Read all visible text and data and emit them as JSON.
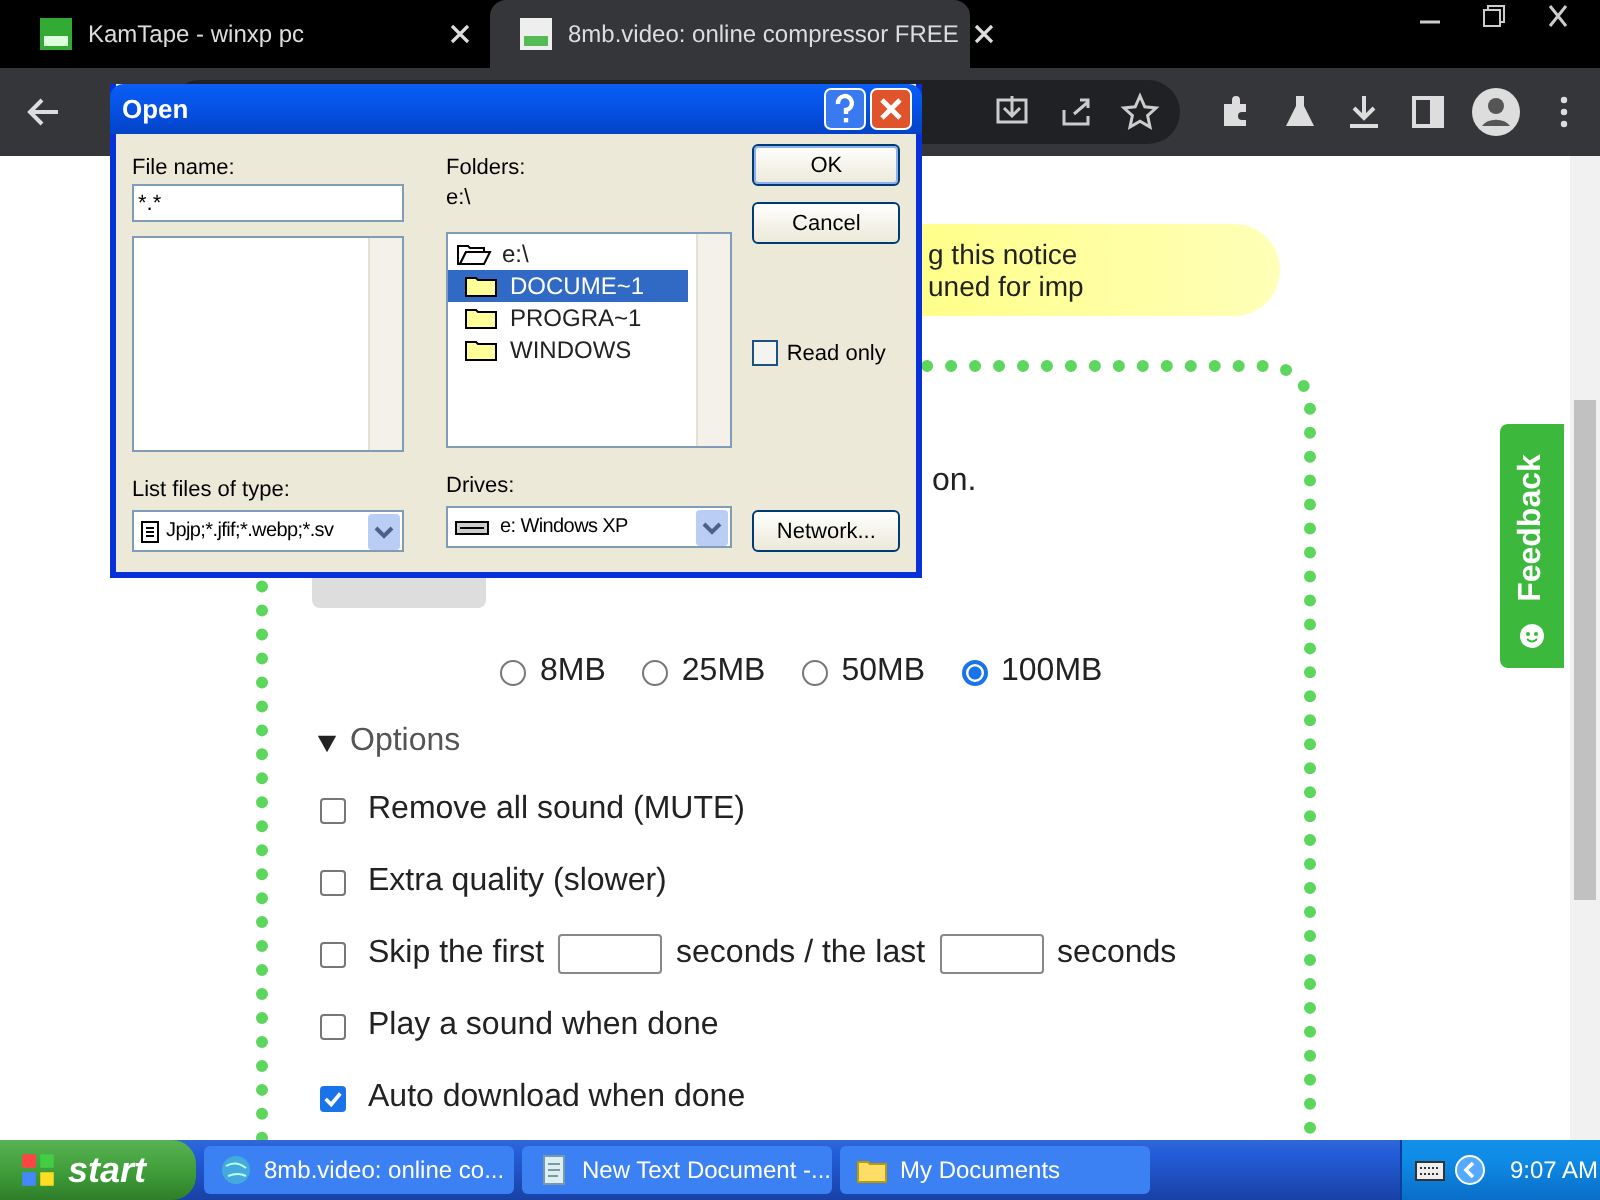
{
  "browser": {
    "tabs": [
      {
        "title": "KamTape - winxp pc",
        "selected": false
      },
      {
        "title": "8mb.video: online compressor FREE",
        "selected": true
      }
    ]
  },
  "page": {
    "notice": [
      "g this notice",
      "uned for imp"
    ],
    "intro_tail": "on.",
    "sizes": [
      {
        "label": "8MB",
        "selected": false
      },
      {
        "label": "25MB",
        "selected": false
      },
      {
        "label": "50MB",
        "selected": false
      },
      {
        "label": "100MB",
        "selected": true
      }
    ],
    "options": {
      "label": "Options",
      "expanded": true,
      "items": [
        {
          "kind": "check",
          "label": "Remove all sound (MUTE)",
          "checked": false
        },
        {
          "kind": "check",
          "label": "Extra quality (slower)",
          "checked": false
        },
        {
          "kind": "skip",
          "label": "Skip the first",
          "middle": "seconds / the last",
          "end": "seconds",
          "checked": false
        },
        {
          "kind": "check",
          "label": "Play a sound when done",
          "checked": false
        },
        {
          "kind": "check",
          "label": "Auto download when done",
          "checked": true
        }
      ]
    },
    "feedback": "Feedback"
  },
  "dialog": {
    "title": "Open",
    "file_name_label": "File name:",
    "file_name": "*.*",
    "folders_label": "Folders:",
    "path": "e:\\",
    "folders": [
      {
        "kind": "open",
        "name": "e:\\",
        "selected": false
      },
      {
        "kind": "folder",
        "name": "DOCUME~1",
        "selected": true
      },
      {
        "kind": "folder",
        "name": "PROGRA~1",
        "selected": false
      },
      {
        "kind": "folder",
        "name": "WINDOWS",
        "selected": false
      }
    ],
    "ok": "OK",
    "cancel": "Cancel",
    "read_only": {
      "label": "Read only",
      "checked": false
    },
    "type_label": "List files of type:",
    "type_value": "Jpjp;*.jfif;*.webp;*.sv",
    "drives_label": "Drives:",
    "drive": "e: Windows XP",
    "network": "Network..."
  },
  "taskbar": {
    "start": "start",
    "items": [
      {
        "kind": "browser",
        "label": "8mb.video: online co..."
      },
      {
        "kind": "note",
        "label": "New Text Document -..."
      },
      {
        "kind": "folder",
        "label": "My Documents"
      }
    ],
    "time": "9:07 AM"
  }
}
